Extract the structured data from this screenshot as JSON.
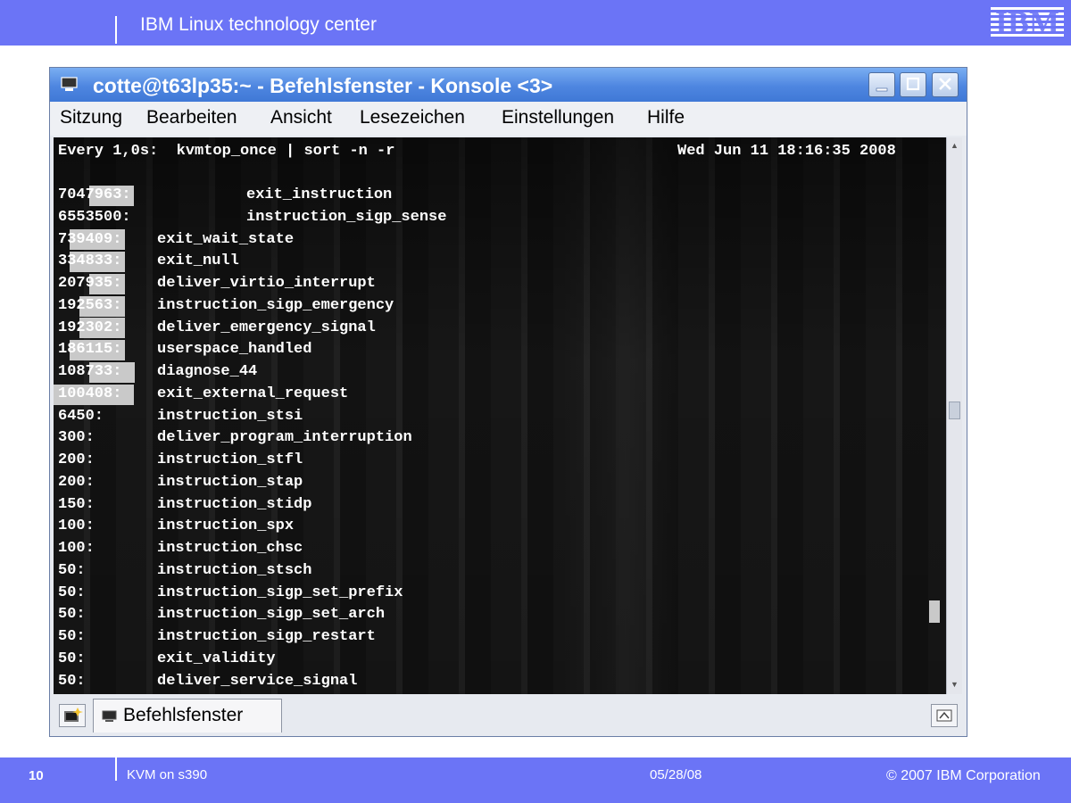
{
  "slide": {
    "header_title": "IBM Linux technology center",
    "logo_text": "IBM",
    "footer": {
      "page_number": "10",
      "title": "KVM on s390",
      "date": "05/28/08",
      "copyright": "© 2007 IBM Corporation"
    }
  },
  "window": {
    "title": "cotte@t63lp35:~ - Befehlsfenster - Konsole <3>",
    "buttons": {
      "minimize": "_",
      "maximize": "□",
      "close": "✕"
    },
    "menu": [
      "Sitzung",
      "Bearbeiten",
      "Ansicht",
      "Lesezeichen",
      "Einstellungen",
      "Hilfe"
    ],
    "tab_label": "Befehlsfenster"
  },
  "terminal": {
    "header_left": "Every 1,0s:  kvmtop_once | sort -n -r",
    "header_right": "Wed Jun 11 18:16:35 2008",
    "rows": [
      {
        "count": "7047963:",
        "name": "exit_instruction"
      },
      {
        "count": "6553500:",
        "name": "instruction_sigp_sense"
      },
      {
        "count": "739409:",
        "name": "exit_wait_state"
      },
      {
        "count": "334833:",
        "name": "exit_null"
      },
      {
        "count": "207935:",
        "name": "deliver_virtio_interrupt"
      },
      {
        "count": "192563:",
        "name": "instruction_sigp_emergency"
      },
      {
        "count": "192302:",
        "name": "deliver_emergency_signal"
      },
      {
        "count": "186115:",
        "name": "userspace_handled"
      },
      {
        "count": "108733:",
        "name": "diagnose_44"
      },
      {
        "count": "100408:",
        "name": "exit_external_request"
      },
      {
        "count": "6450:",
        "name": "instruction_stsi"
      },
      {
        "count": "300:",
        "name": "deliver_program_interruption"
      },
      {
        "count": "200:",
        "name": "instruction_stfl"
      },
      {
        "count": "200:",
        "name": "instruction_stap"
      },
      {
        "count": "150:",
        "name": "instruction_stidp"
      },
      {
        "count": "100:",
        "name": "instruction_spx"
      },
      {
        "count": "100:",
        "name": "instruction_chsc"
      },
      {
        "count": "50:",
        "name": "instruction_stsch"
      },
      {
        "count": "50:",
        "name": "instruction_sigp_set_prefix"
      },
      {
        "count": "50:",
        "name": "instruction_sigp_set_arch"
      },
      {
        "count": "50:",
        "name": "instruction_sigp_restart"
      },
      {
        "count": "50:",
        "name": "exit_validity"
      },
      {
        "count": "50:",
        "name": "deliver_service_signal"
      }
    ]
  }
}
